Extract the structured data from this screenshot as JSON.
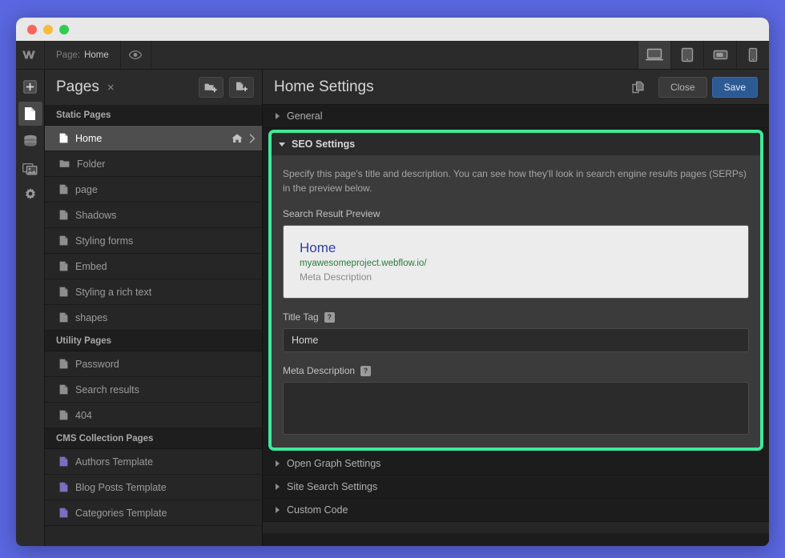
{
  "window": {
    "traffic_lights": [
      "close",
      "minimize",
      "maximize"
    ]
  },
  "topbar": {
    "logo": "W",
    "page_label": "Page:",
    "page_value": "Home",
    "preview_icon": "eye-icon",
    "devices": [
      {
        "name": "desktop",
        "icon": "desktop-icon",
        "active": true
      },
      {
        "name": "tablet-portrait",
        "icon": "tablet-portrait-icon",
        "active": false
      },
      {
        "name": "tablet-landscape",
        "icon": "tablet-landscape-icon",
        "active": false
      },
      {
        "name": "mobile",
        "icon": "mobile-icon",
        "active": false
      }
    ]
  },
  "rail": {
    "items": [
      {
        "name": "add-elements",
        "icon": "plus-square-icon",
        "active": false
      },
      {
        "name": "pages",
        "icon": "page-icon",
        "active": true
      },
      {
        "name": "cms",
        "icon": "database-icon",
        "active": false
      },
      {
        "name": "assets",
        "icon": "images-icon",
        "active": false
      },
      {
        "name": "settings",
        "icon": "gear-icon",
        "active": false
      }
    ]
  },
  "pages_panel": {
    "title": "Pages",
    "close_glyph": "×",
    "add_folder_icon": "folder-plus-icon",
    "add_page_icon": "page-plus-icon",
    "groups": [
      {
        "label": "Static Pages",
        "items": [
          {
            "label": "Home",
            "icon": "page-icon",
            "selected": true,
            "home": true
          },
          {
            "label": "Folder",
            "icon": "folder-icon",
            "selected": false,
            "home": false
          },
          {
            "label": "page",
            "icon": "page-icon",
            "selected": false,
            "home": false
          },
          {
            "label": "Shadows",
            "icon": "page-icon",
            "selected": false,
            "home": false
          },
          {
            "label": "Styling forms",
            "icon": "page-icon",
            "selected": false,
            "home": false
          },
          {
            "label": "Embed",
            "icon": "page-icon",
            "selected": false,
            "home": false
          },
          {
            "label": "Styling a rich text",
            "icon": "page-icon",
            "selected": false,
            "home": false
          },
          {
            "label": "shapes",
            "icon": "page-icon",
            "selected": false,
            "home": false
          }
        ]
      },
      {
        "label": "Utility Pages",
        "items": [
          {
            "label": "Password",
            "icon": "page-icon",
            "selected": false,
            "home": false
          },
          {
            "label": "Search results",
            "icon": "page-icon",
            "selected": false,
            "home": false
          },
          {
            "label": "404",
            "icon": "page-icon",
            "selected": false,
            "home": false
          }
        ]
      },
      {
        "label": "CMS Collection Pages",
        "items": [
          {
            "label": "Authors Template",
            "icon": "cms-page-icon",
            "selected": false,
            "home": false
          },
          {
            "label": "Blog Posts Template",
            "icon": "cms-page-icon",
            "selected": false,
            "home": false
          },
          {
            "label": "Categories Template",
            "icon": "cms-page-icon",
            "selected": false,
            "home": false
          }
        ]
      }
    ]
  },
  "settings": {
    "title": "Home Settings",
    "duplicate_icon": "duplicate-icon",
    "close_label": "Close",
    "save_label": "Save",
    "sections": {
      "general": {
        "label": "General",
        "expanded": false
      },
      "seo": {
        "label": "SEO Settings",
        "expanded": true,
        "highlight_color": "#3fe99a",
        "description": "Specify this page's title and description. You can see how they'll look in search engine results pages (SERPs) in the preview below.",
        "preview_label": "Search Result Preview",
        "preview": {
          "title": "Home",
          "url": "myawesomeproject.webflow.io/",
          "meta": "Meta Description"
        },
        "title_tag": {
          "label": "Title Tag",
          "help": "?",
          "value": "Home"
        },
        "meta_description": {
          "label": "Meta Description",
          "help": "?",
          "value": "",
          "placeholder": ""
        }
      },
      "collapsed": [
        {
          "label": "Open Graph Settings"
        },
        {
          "label": "Site Search Settings"
        },
        {
          "label": "Custom Code"
        }
      ]
    }
  },
  "colors": {
    "desktop_background": "#5a67e0",
    "accent_highlight": "#3fe99a",
    "save_button": "#2c5a94",
    "serp_title": "#2f3ea8",
    "serp_url": "#2a7a3e"
  }
}
